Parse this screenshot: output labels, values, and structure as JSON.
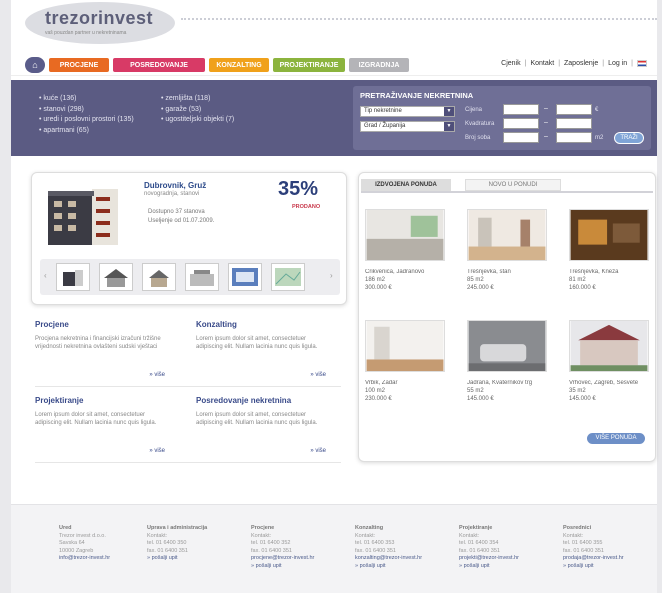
{
  "header": {
    "logo": "trezorinvest",
    "logo_sub": "vaš pouzdan partner u nekretninama",
    "home_icon": "home-icon",
    "tabs": [
      {
        "label": "PROCJENE",
        "color": "#e86a22"
      },
      {
        "label": "POSREDOVANJE",
        "color": "#d83a66"
      },
      {
        "label": "KONZALTING",
        "color": "#f0a11b"
      },
      {
        "label": "PROJEKTIRANJE",
        "color": "#8cb43e"
      },
      {
        "label": "IZGRADNJA",
        "color": "#b4b4b8"
      }
    ],
    "links": [
      "Cjenik",
      "Kontakt",
      "Zaposlenje",
      "Log in"
    ]
  },
  "categories": {
    "col1": [
      "kuće (136)",
      "stanovi (298)",
      "uredi i poslovni prostori (135)",
      "apartmani (65)"
    ],
    "col2": [
      "zemljišta (118)",
      "garaže (53)",
      "ugostiteljski objekti (7)"
    ]
  },
  "search": {
    "title": "PRETRAŽIVANJE NEKRETNINA",
    "type_select": "Tip nekretnine",
    "region_select": "Grad / Županija",
    "labels": [
      "Cijena",
      "Kvadratura",
      "Broj soba"
    ],
    "unit": "€",
    "area_unit": "m2",
    "button": "TRAŽI"
  },
  "featured": {
    "title": "Dubrovnik, Gruž",
    "subtitle": "novogradnja, stanovi",
    "line1": "Dostupno 37 stanova",
    "line2": "Useljenje od 01.07.2009.",
    "percent": "35%",
    "percent_label": "PRODANO"
  },
  "services": [
    {
      "title": "Procjene",
      "text": "Procjena nekretnina i financijski izračuni tržišne vrijednosti nekretnina ovlašteni sudski vještaci",
      "more": "» više"
    },
    {
      "title": "Konzalting",
      "text": "Lorem ipsum dolor sit amet, consectetuer adipiscing elit. Nullam lacinia nunc quis ligula.",
      "more": "» više"
    },
    {
      "title": "Projektiranje",
      "text": "Lorem ipsum dolor sit amet, consectetuer adipiscing elit. Nullam lacinia nunc quis ligula.",
      "more": "» više"
    },
    {
      "title": "Posredovanje nekretnina",
      "text": "Lorem ipsum dolor sit amet, consectetuer adipiscing elit. Nullam lacinia nunc quis ligula.",
      "more": "» više"
    }
  ],
  "offers": {
    "tab_active": "IZDVOJENA PONUDA",
    "tab_inactive": "NOVO U PONUDI",
    "items": [
      {
        "loc": "Crikvenica, Jadranovo",
        "area": "186 m2",
        "price": "300.000 €"
      },
      {
        "loc": "Trešnjevka, stan",
        "area": "85 m2",
        "price": "245.000 €"
      },
      {
        "loc": "Trešnjevka, Kneza",
        "area": "81 m2",
        "price": "160.000 €"
      },
      {
        "loc": "Vrbik, Zadar",
        "area": "100 m2",
        "price": "230.000 €"
      },
      {
        "loc": "Jadrana, Kvaternikov trg",
        "area": "55 m2",
        "price": "145.000 €"
      },
      {
        "loc": "Vrhovec, Zagreb, Sesvete",
        "area": "35 m2",
        "price": "145.000 €"
      }
    ],
    "more_button": "VIŠE PONUDA"
  },
  "footer": [
    {
      "title": "Ured",
      "lines": [
        "Trezor invest d.o.o.",
        "Savska 64",
        "10000 Zagreb",
        "info@trezor-invest.hr"
      ]
    },
    {
      "title": "Uprava i administracija",
      "lines": [
        "Kontakt:",
        "tel. 01 6400 350",
        "fax. 01 6400 351"
      ],
      "link": "» pošalji upit"
    },
    {
      "title": "Procjene",
      "lines": [
        "Kontakt:",
        "tel. 01 6400 352",
        "fax. 01 6400 351",
        "procjene@trezor-invest.hr"
      ],
      "link": "» pošalji upit"
    },
    {
      "title": "Konzalting",
      "lines": [
        "Kontakt:",
        "tel. 01 6400 353",
        "fax. 01 6400 351",
        "konzalting@trezor-invest.hr"
      ],
      "link": "» pošalji upit"
    },
    {
      "title": "Projektiranje",
      "lines": [
        "Kontakt:",
        "tel. 01 6400 354",
        "fax. 01 6400 351",
        "projekti@trezor-invest.hr"
      ],
      "link": "» pošalji upit"
    },
    {
      "title": "Posrednici",
      "lines": [
        "Kontakt:",
        "tel. 01 6400 355",
        "fax. 01 6400 351",
        "prodaja@trezor-invest.hr"
      ],
      "link": "» pošalji upit"
    }
  ]
}
